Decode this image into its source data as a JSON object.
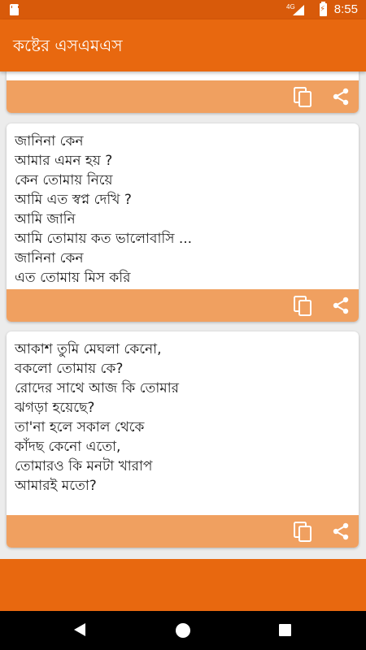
{
  "status_bar": {
    "network": "4G",
    "time": "8:55"
  },
  "app_bar": {
    "title": "কষ্টের এসএমএস"
  },
  "cards": [
    {
      "text": ""
    },
    {
      "text": "জানিনা কেন\nআমার এমন হয় ?\nকেন তোমায় নিয়ে\nআমি এত স্বপ্ন দেখি ?\nআমি জানি\nআমি তোমায় কত ভালোবাসি ...\nজানিনা কেন\nএত তোমায় মিস করি"
    },
    {
      "text": "আকাশ তুমি মেঘলা কেনো,\nবকলো তোমায় কে?\nরোদের সাথে আজ কি তোমার\nঝগড়া হয়েছে?\nতা'না হলে সকাল থেকে\nকাঁদছ কেনো এতো,\nতোমারও কি মনটা খারাপ\nআমারই মতো?"
    }
  ],
  "colors": {
    "status_bar": "#d85a0a",
    "app_bar": "#e8680f",
    "card_footer": "#f0a060",
    "background": "#ececec"
  },
  "icons": {
    "copy": "copy-icon",
    "share": "share-icon"
  }
}
